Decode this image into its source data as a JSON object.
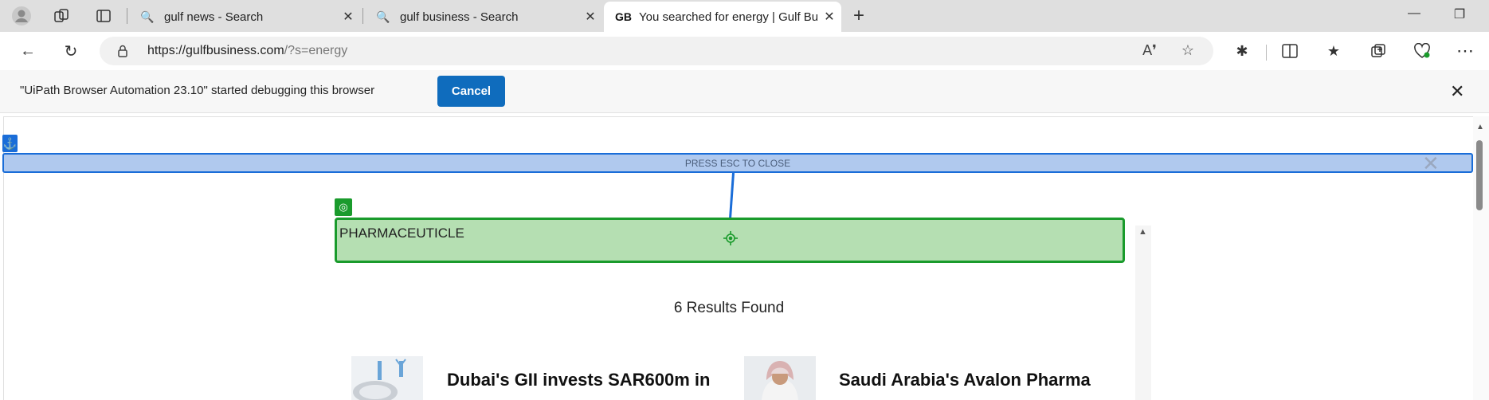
{
  "browser": {
    "tabs": [
      {
        "label": "gulf news - Search",
        "icon": "search-icon"
      },
      {
        "label": "gulf business - Search",
        "icon": "search-icon"
      },
      {
        "label": "You searched for energy | Gulf Bu",
        "favicon_text": "GB"
      }
    ],
    "address": {
      "url_host": "https://gulfbusiness.com",
      "url_path": "/?s=energy"
    }
  },
  "infobar": {
    "message": "\"UiPath Browser Automation 23.10\" started debugging this browser",
    "cancel_label": "Cancel"
  },
  "overlay": {
    "esc_label": "PRESS ESC TO CLOSE",
    "target_text": "PHARMACEUTICLE"
  },
  "page": {
    "results_label": "6 Results Found",
    "articles": [
      {
        "headline": "Dubai's GII invests SAR600m in"
      },
      {
        "headline": "Saudi Arabia's Avalon Pharma"
      }
    ]
  },
  "colors": {
    "accent": "#0f6cbd",
    "highlight_blue": "#1a6dd8",
    "highlight_green": "#1a9b2c"
  }
}
